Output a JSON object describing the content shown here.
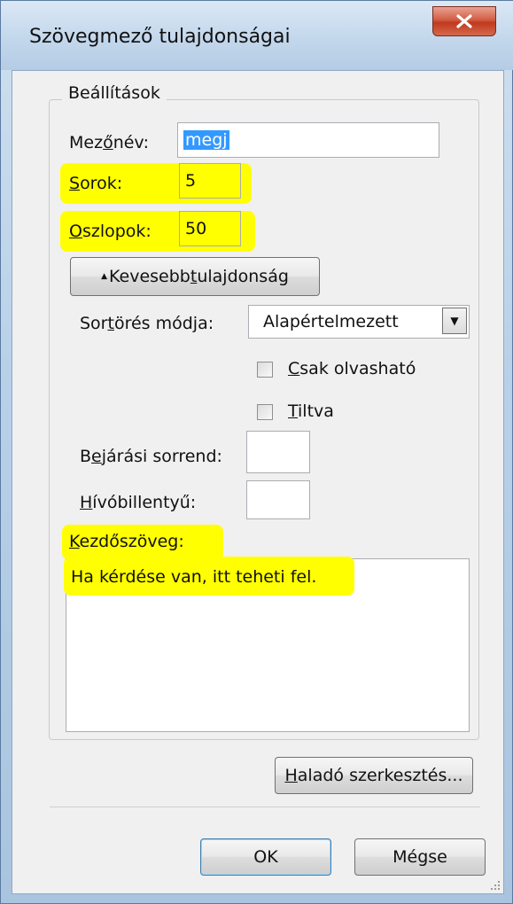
{
  "window": {
    "title": "Szövegmező tulajdonságai",
    "close_label": "x"
  },
  "group": {
    "legend": "Beállítások"
  },
  "fields": {
    "name": {
      "label_prefix": "Mez",
      "label_underlined": "ő",
      "label_suffix": "név:",
      "value": "megj"
    },
    "rows": {
      "label_underlined": "S",
      "label_suffix": "orok:",
      "value": "5"
    },
    "columns": {
      "label_underlined": "O",
      "label_suffix": "szlopok:",
      "value": "50"
    }
  },
  "less_button": {
    "arrow": "▲",
    "prefix": "Kevesebb ",
    "underlined": "t",
    "suffix": "ulajdonság"
  },
  "wrap": {
    "label_prefix": "Sor",
    "label_underlined": "t",
    "label_suffix": "örés módja:",
    "selected": "Alapértelmezett",
    "arrow": "▼"
  },
  "checkboxes": {
    "readonly": {
      "underlined": "C",
      "suffix": "sak olvasható",
      "checked": false
    },
    "disabled": {
      "underlined": "T",
      "suffix": "iltva",
      "checked": false
    }
  },
  "tab_order": {
    "label_prefix": "B",
    "label_underlined": "e",
    "label_suffix": "járási sorrend:",
    "value": ""
  },
  "hotkey": {
    "label_underlined": "H",
    "label_suffix": "ívóbillentyű:",
    "value": ""
  },
  "initial_text": {
    "label_underlined": "K",
    "label_suffix": "ezdőszöveg:",
    "value": "Ha kérdése van, itt teheti fel."
  },
  "advanced_button": {
    "underlined": "H",
    "suffix": "aladó szerkesztés..."
  },
  "buttons": {
    "ok": "OK",
    "cancel": "Mégse"
  },
  "colors": {
    "highlight": "#ffff00",
    "accent": "#3399ff",
    "close": "#c0391d"
  }
}
